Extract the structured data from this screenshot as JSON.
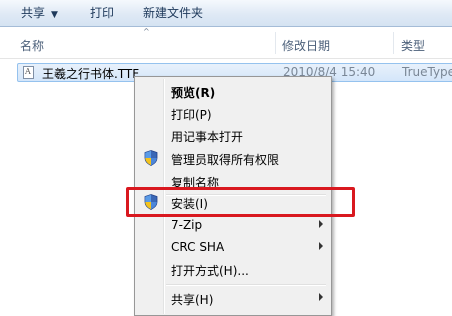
{
  "toolbar": {
    "share_label": "共享",
    "share_caret": "▼",
    "print_label": "打印",
    "new_folder_label": "新建文件夹"
  },
  "columns": {
    "name": "名称",
    "date": "修改日期",
    "type": "类型",
    "sort_indicator": "^"
  },
  "file": {
    "name": "王羲之行书体.TTF",
    "date": "2010/8/4 15:40",
    "type": "TrueType"
  },
  "context_menu": {
    "items": [
      {
        "label": "预览(R)",
        "bold": true,
        "icon": "",
        "submenu": false
      },
      {
        "label": "打印(P)",
        "bold": false,
        "icon": "",
        "submenu": false
      },
      {
        "label": "用记事本打开",
        "bold": false,
        "icon": "",
        "submenu": false
      },
      {
        "label": "管理员取得所有权限",
        "bold": false,
        "icon": "uac-shield-icon",
        "submenu": false
      },
      {
        "label": "复制名称",
        "bold": false,
        "icon": "",
        "submenu": false
      },
      {
        "label": "安装(I)",
        "bold": false,
        "icon": "uac-shield-icon",
        "submenu": false
      },
      {
        "label": "7-Zip",
        "bold": false,
        "icon": "",
        "submenu": true
      },
      {
        "label": "CRC SHA",
        "bold": false,
        "icon": "",
        "submenu": true
      },
      {
        "label": "打开方式(H)...",
        "bold": false,
        "icon": "",
        "submenu": false
      },
      {
        "label": "共享(H)",
        "bold": false,
        "icon": "",
        "submenu": true
      }
    ]
  },
  "colors": {
    "highlight": "#d9181f",
    "selection": "#d4e6fa"
  }
}
